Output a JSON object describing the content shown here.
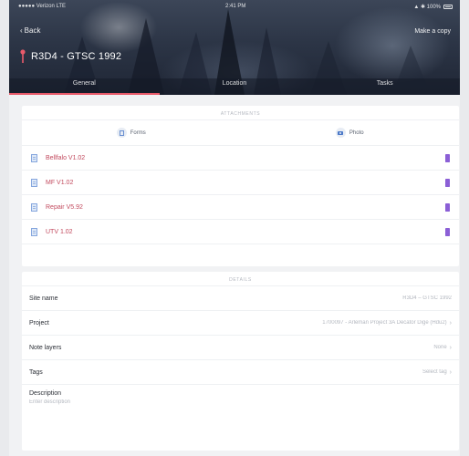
{
  "status_bar": {
    "carrier": "●●●●● Verizon LTE",
    "time": "2:41 PM",
    "battery_text": "▲ ✱ 100%"
  },
  "header": {
    "back_label": "Back",
    "copy_label": "Make a copy",
    "title": "R3D4 - GTSC 1992",
    "accent_color": "#e85a6a"
  },
  "tabs": [
    {
      "label": "General",
      "active": true
    },
    {
      "label": "Location",
      "active": false
    },
    {
      "label": "Tasks",
      "active": false
    }
  ],
  "attachments": {
    "section_title": "ATTACHMENTS",
    "add_form_label": "Forms",
    "add_photo_label": "Photo",
    "items": [
      {
        "name": "Bellfalo V1.02",
        "icon": "document-icon"
      },
      {
        "name": "MF V1.02",
        "icon": "document-icon"
      },
      {
        "name": "Repair V5.92",
        "icon": "document-icon"
      },
      {
        "name": "UTV 1.02",
        "icon": "document-icon"
      }
    ],
    "link_color": "#c24a5e",
    "action_color": "#8b5fd6"
  },
  "details": {
    "section_title": "DETAILS",
    "rows": [
      {
        "label": "Site name",
        "value": "R3D4 – GTSC 1992"
      },
      {
        "label": "Project",
        "value": "1700097 - Arleman Project 3A Decator Dige (Hdu2)"
      },
      {
        "label": "Note layers",
        "value": "None"
      },
      {
        "label": "Tags",
        "value": "Select tag"
      }
    ],
    "description_label": "Description",
    "description_placeholder": "Enter description",
    "description_value": ""
  }
}
